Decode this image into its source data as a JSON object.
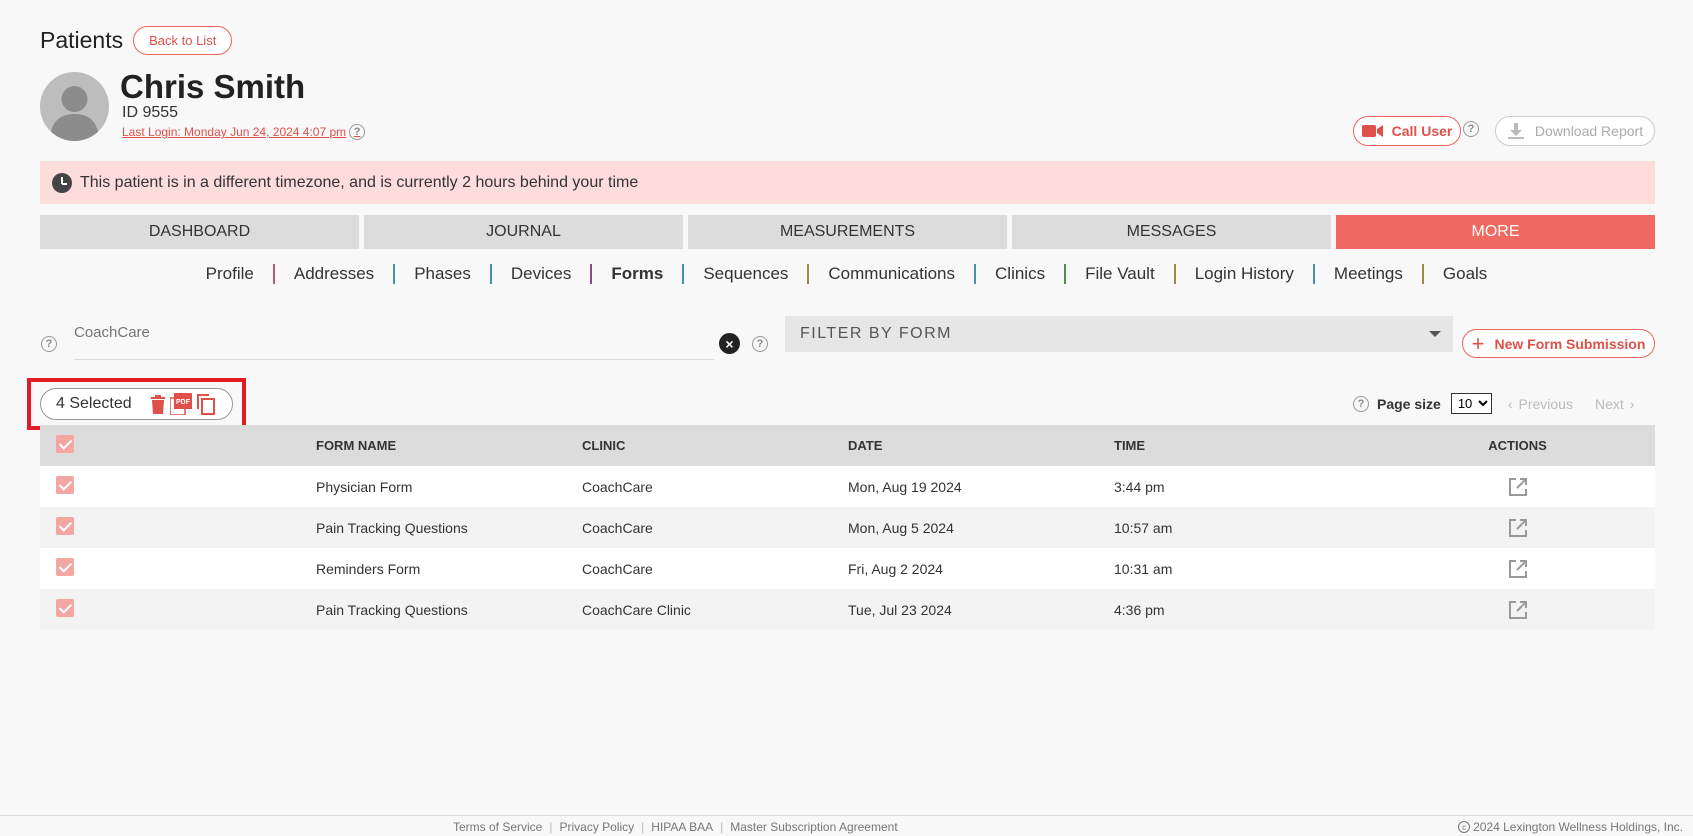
{
  "header": {
    "title": "Patients",
    "back_label": "Back to List"
  },
  "patient": {
    "name": "Chris Smith",
    "id": "ID 9555",
    "last_login": "Last Login: Monday Jun 24, 2024 4:07 pm"
  },
  "actions": {
    "call_label": "Call User",
    "download_label": "Download Report"
  },
  "banner": {
    "text": "This patient is in a different timezone, and is currently 2 hours behind your time"
  },
  "main_tabs": [
    "DASHBOARD",
    "JOURNAL",
    "MEASUREMENTS",
    "MESSAGES",
    "MORE"
  ],
  "sub_nav": [
    "Profile",
    "Addresses",
    "Phases",
    "Devices",
    "Forms",
    "Sequences",
    "Communications",
    "Clinics",
    "File Vault",
    "Login History",
    "Meetings",
    "Goals"
  ],
  "filters": {
    "search_placeholder": "CoachCare",
    "form_filter": "FILTER BY FORM",
    "new_form_label": "New Form Submission"
  },
  "selection": {
    "label": "4 Selected"
  },
  "pagination": {
    "page_size_label": "Page size",
    "page_size": "10",
    "prev": "Previous",
    "next": "Next"
  },
  "table": {
    "headers": {
      "name": "FORM NAME",
      "clinic": "CLINIC",
      "date": "DATE",
      "time": "TIME",
      "actions": "ACTIONS"
    },
    "rows": [
      {
        "name": "Physician Form",
        "clinic": "CoachCare",
        "date": "Mon, Aug 19 2024",
        "time": "3:44 pm"
      },
      {
        "name": "Pain Tracking Questions",
        "clinic": "CoachCare",
        "date": "Mon, Aug 5 2024",
        "time": "10:57 am"
      },
      {
        "name": "Reminders Form",
        "clinic": "CoachCare",
        "date": "Fri, Aug 2 2024",
        "time": "10:31 am"
      },
      {
        "name": "Pain Tracking Questions",
        "clinic": "CoachCare Clinic",
        "date": "Tue, Jul 23 2024",
        "time": "4:36 pm"
      }
    ]
  },
  "footer": {
    "links": [
      "Terms of Service",
      "Privacy Policy",
      "HIPAA BAA",
      "Master Subscription Agreement"
    ],
    "copyright": "2024 Lexington Wellness Holdings, Inc."
  },
  "colors": {
    "accent": "#f06a62",
    "banner": "#fddcdc",
    "checkbox": "#f4a6a2",
    "highlight_outline": "#e21b24"
  }
}
